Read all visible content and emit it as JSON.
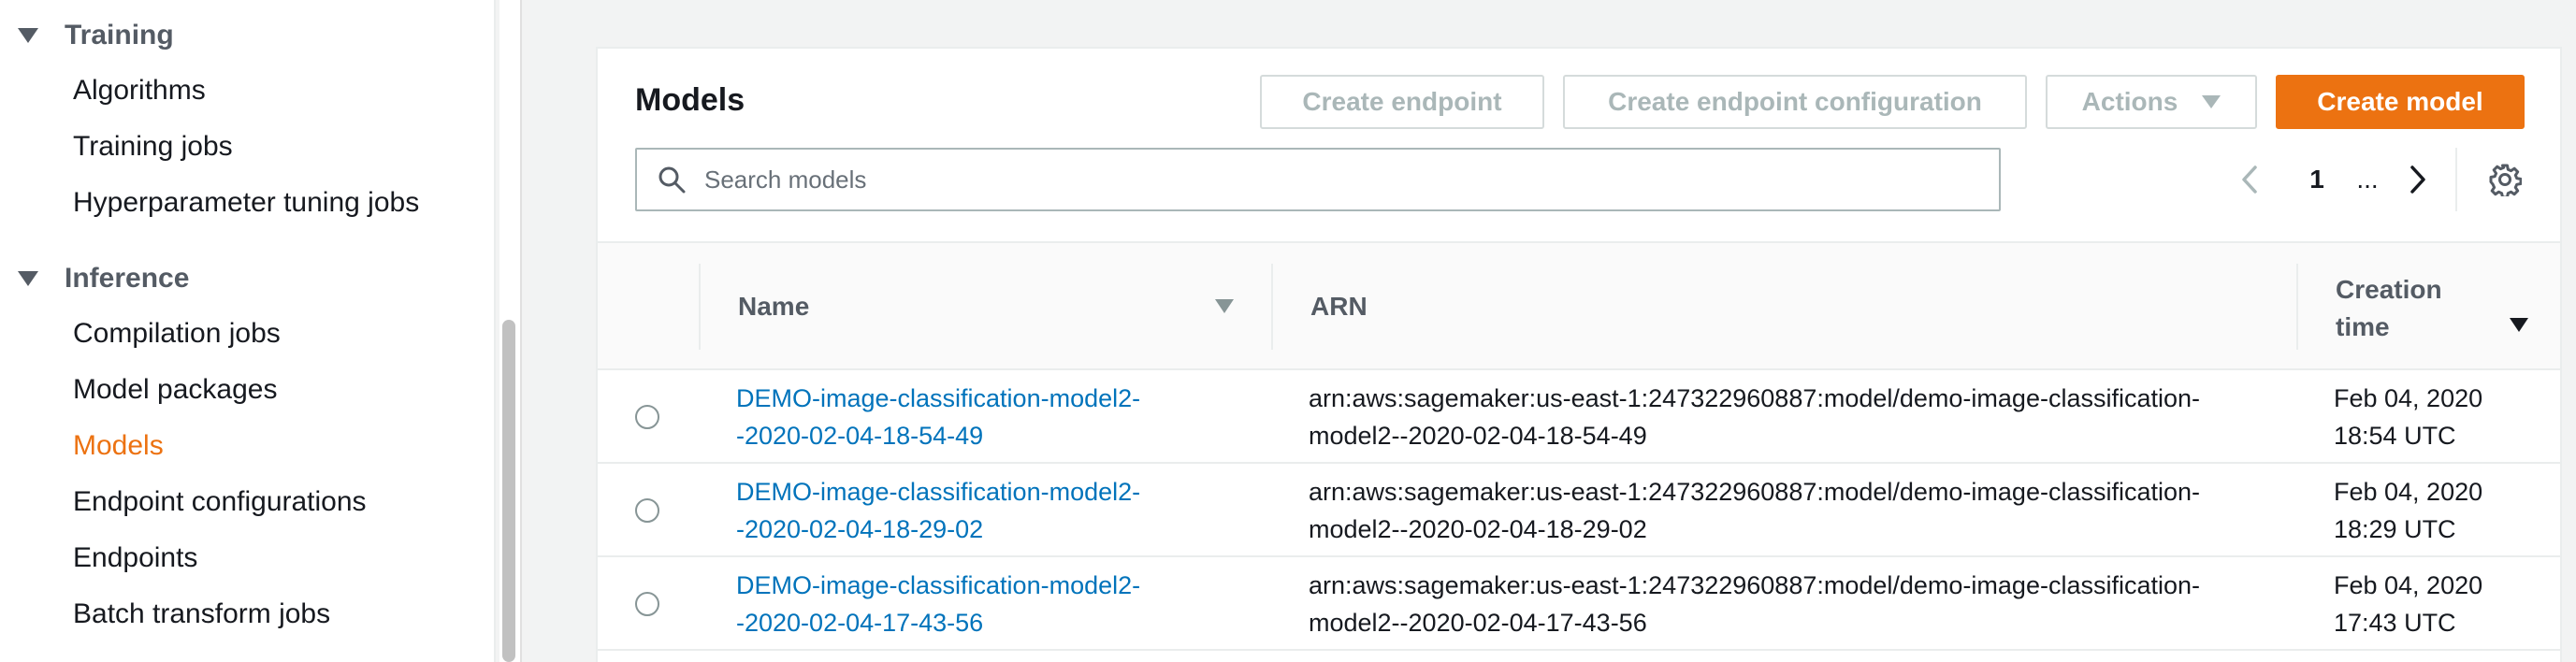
{
  "sidebar": {
    "sections": [
      {
        "label": "Training",
        "items": [
          "Algorithms",
          "Training jobs",
          "Hyperparameter tuning jobs"
        ]
      },
      {
        "label": "Inference",
        "items": [
          "Compilation jobs",
          "Model packages",
          "Models",
          "Endpoint configurations",
          "Endpoints",
          "Batch transform jobs"
        ]
      }
    ],
    "active_item": "Models"
  },
  "panel": {
    "title": "Models",
    "buttons": {
      "create_endpoint": "Create endpoint",
      "create_endpoint_configuration": "Create endpoint configuration",
      "actions": "Actions",
      "create_model": "Create model"
    },
    "search": {
      "placeholder": "Search models",
      "value": ""
    },
    "pagination": {
      "current_page": "1",
      "more": "..."
    }
  },
  "table": {
    "columns": {
      "name": "Name",
      "arn": "ARN",
      "creation_time_line1": "Creation",
      "creation_time_line2": "time"
    },
    "rows": [
      {
        "name_line1": "DEMO-image-classification-model2-",
        "name_line2": "-2020-02-04-18-54-49",
        "arn_line1": "arn:aws:sagemaker:us-east-1:247322960887:model/demo-image-classification-",
        "arn_line2": "model2--2020-02-04-18-54-49",
        "time_line1": "Feb 04, 2020",
        "time_line2": "18:54 UTC"
      },
      {
        "name_line1": "DEMO-image-classification-model2-",
        "name_line2": "-2020-02-04-18-29-02",
        "arn_line1": "arn:aws:sagemaker:us-east-1:247322960887:model/demo-image-classification-",
        "arn_line2": "model2--2020-02-04-18-29-02",
        "time_line1": "Feb 04, 2020",
        "time_line2": "18:29 UTC"
      },
      {
        "name_line1": "DEMO-image-classification-model2-",
        "name_line2": "-2020-02-04-17-43-56",
        "arn_line1": "arn:aws:sagemaker:us-east-1:247322960887:model/demo-image-classification-",
        "arn_line2": "model2--2020-02-04-17-43-56",
        "time_line1": "Feb 04, 2020",
        "time_line2": "17:43 UTC"
      }
    ]
  },
  "colors": {
    "accent": "#ec7211",
    "link": "#0073bb",
    "disabled_text": "#aab7b8"
  },
  "icons": [
    "caret-down-icon",
    "search-icon",
    "chevron-left-icon",
    "chevron-right-icon",
    "gear-icon",
    "radio-icon",
    "sort-caret-icon"
  ]
}
